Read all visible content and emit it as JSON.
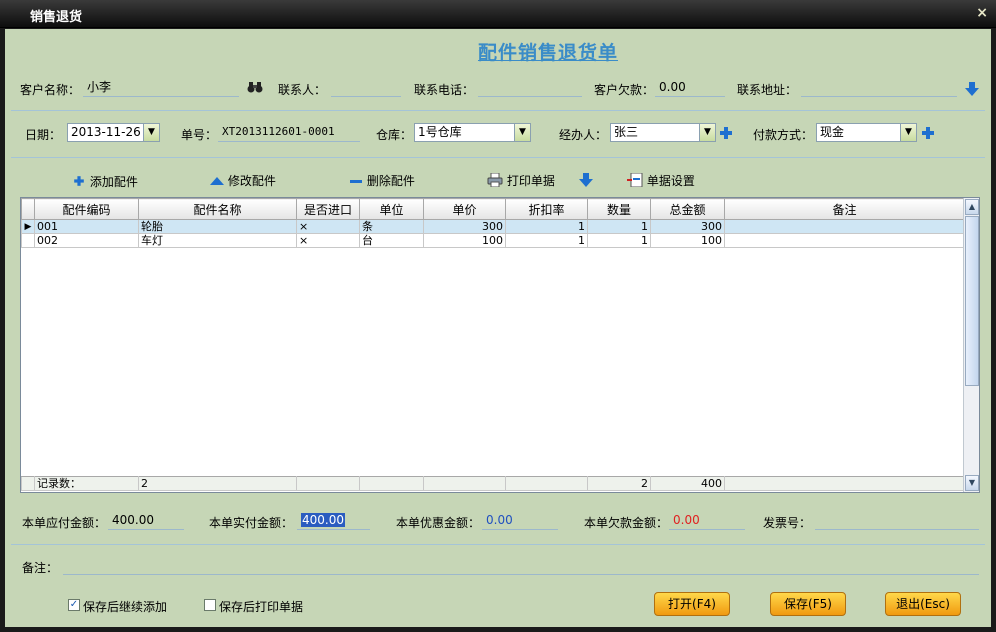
{
  "window": {
    "title": "销售退货",
    "close": "×"
  },
  "heading": "配件销售退货单",
  "row1": {
    "customer_label": "客户名称：",
    "customer_value": "小李",
    "contact_label": "联系人：",
    "contact_value": "",
    "phone_label": "联系电话：",
    "phone_value": "",
    "debt_label": "客户欠款：",
    "debt_value": "0.00",
    "address_label": "联系地址：",
    "address_value": ""
  },
  "row2": {
    "date_label": "日期：",
    "date_value": "2013-11-26",
    "no_label": "单号：",
    "no_value": "XT2013112601-0001",
    "warehouse_label": "仓库：",
    "warehouse_value": "1号仓库",
    "handler_label": "经办人：",
    "handler_value": "张三",
    "payment_label": "付款方式：",
    "payment_value": "现金"
  },
  "toolbar": {
    "add": "添加配件",
    "edit": "修改配件",
    "delete": "删除配件",
    "print": "打印单据",
    "settings": "单据设置"
  },
  "grid": {
    "columns": [
      "配件编码",
      "配件名称",
      "是否进口",
      "单位",
      "单价",
      "折扣率",
      "数量",
      "总金额",
      "备注"
    ],
    "rows": [
      {
        "code": "001",
        "name": "轮胎",
        "imported": "×",
        "unit": "条",
        "price": "300",
        "discount": "1",
        "qty": "1",
        "total": "300",
        "note": ""
      },
      {
        "code": "002",
        "name": "车灯",
        "imported": "×",
        "unit": "台",
        "price": "100",
        "discount": "1",
        "qty": "1",
        "total": "100",
        "note": ""
      }
    ],
    "footer": {
      "label": "记录数：",
      "count": "2",
      "qty": "2",
      "total": "400"
    }
  },
  "summary": {
    "payable_label": "本单应付金额：",
    "payable_value": "400.00",
    "paid_label": "本单实付金额：",
    "paid_value": "400.00",
    "discount_label": "本单优惠金额：",
    "discount_value": "0.00",
    "owed_label": "本单欠款金额：",
    "owed_value": "0.00",
    "invoice_label": "发票号：",
    "invoice_value": ""
  },
  "remark": {
    "label": "备注：",
    "value": ""
  },
  "options": {
    "continue_add": "保存后继续添加",
    "continue_add_checked": "✓",
    "print_after": "保存后打印单据"
  },
  "buttons": {
    "open": "打开(F4)",
    "save": "保存(F5)",
    "exit": "退出(Esc)"
  },
  "colors": {
    "client_bg": "#c6d6b6",
    "heading": "#3a8cc8",
    "accent_blue": "#1e6fd0",
    "red_value": "#e02020",
    "blue_value": "#2050c0"
  }
}
